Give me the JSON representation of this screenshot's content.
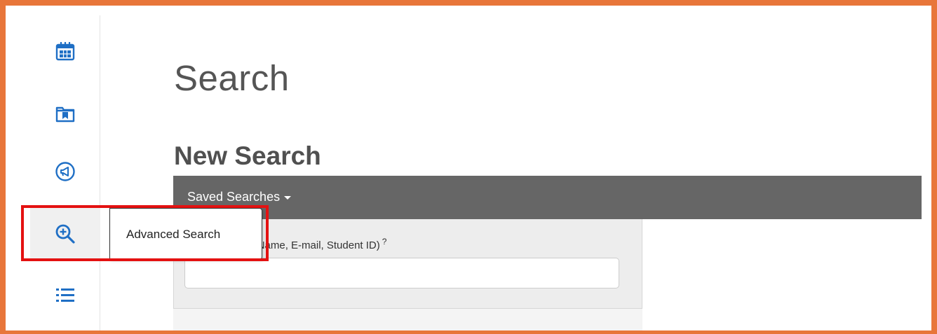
{
  "colors": {
    "frame_border": "#e8763a",
    "icon_blue": "#1f6fc5",
    "toolbar_bg": "#666666",
    "highlight": "#e41111"
  },
  "sidebar": {
    "items": [
      {
        "icon": "calendar-icon",
        "active": false
      },
      {
        "icon": "folder-bookmark-icon",
        "active": false
      },
      {
        "icon": "megaphone-icon",
        "active": false
      },
      {
        "icon": "zoom-in-search-icon",
        "active": true
      },
      {
        "icon": "list-icon",
        "active": false
      }
    ]
  },
  "tooltip": {
    "text": "Advanced Search"
  },
  "main": {
    "page_title": "Search",
    "section_title": "New Search",
    "saved_searches_label": "Saved Searches",
    "search_field": {
      "label_visible": "st Name, Last Name, E-mail, Student ID)",
      "help": "?",
      "value": "",
      "placeholder": ""
    }
  }
}
